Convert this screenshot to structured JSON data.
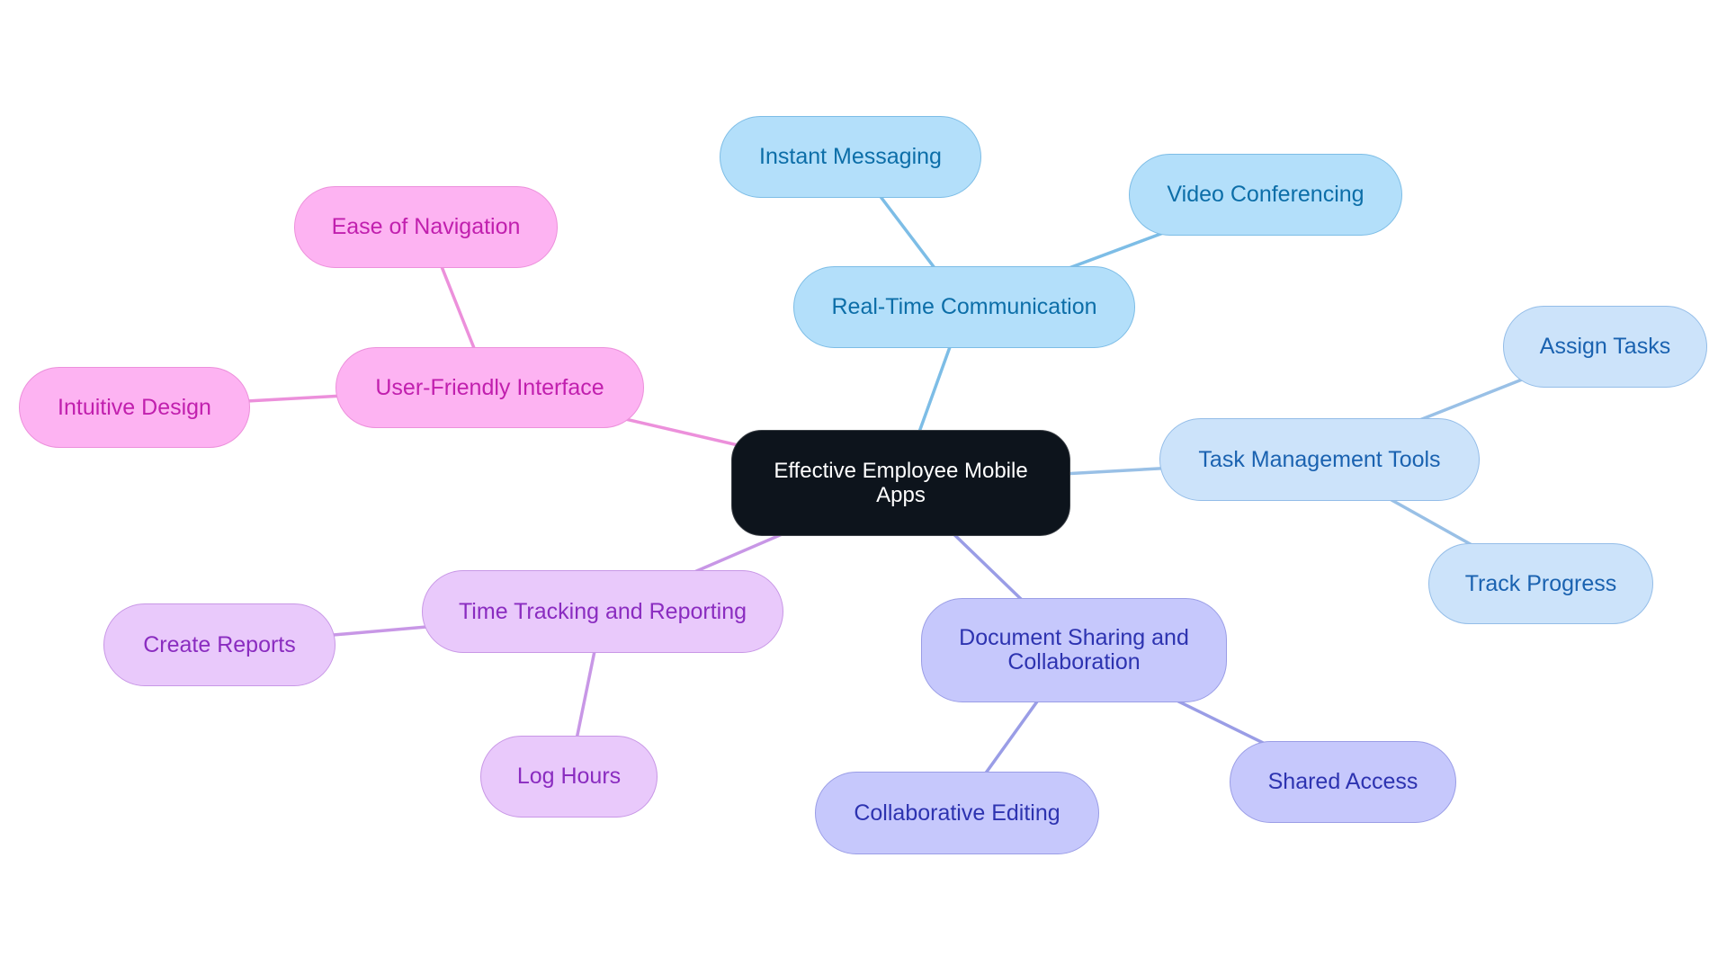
{
  "diagram": {
    "type": "mindmap",
    "root": {
      "id": "root",
      "label": "Effective Employee Mobile Apps"
    },
    "palette": {
      "root": {
        "fill": "#0d141c",
        "stroke": "#3a3f45",
        "text": "#ffffff"
      },
      "sky": {
        "fill": "#b3dffa",
        "stroke": "#7dbde6",
        "text": "#0c6ea8",
        "edge": "#7dbde6"
      },
      "light-blue": {
        "fill": "#cce3fa",
        "stroke": "#94bde8",
        "text": "#1a62b0",
        "edge": "#99c0e6"
      },
      "indigo": {
        "fill": "#c6c8fc",
        "stroke": "#9a9de6",
        "text": "#2d33b0",
        "edge": "#9a9de6"
      },
      "lavender": {
        "fill": "#e9c9fb",
        "stroke": "#c897e6",
        "text": "#8a2cc0",
        "edge": "#c897e6"
      },
      "pink": {
        "fill": "#fdb3f2",
        "stroke": "#ec90db",
        "text": "#c11fae",
        "edge": "#ec90db"
      }
    },
    "branches": [
      {
        "id": "rtc",
        "label": "Real-Time Communication",
        "color": "sky",
        "children": [
          {
            "id": "im",
            "label": "Instant Messaging"
          },
          {
            "id": "vc",
            "label": "Video Conferencing"
          }
        ]
      },
      {
        "id": "tmt",
        "label": "Task Management Tools",
        "color": "light-blue",
        "children": [
          {
            "id": "at",
            "label": "Assign Tasks"
          },
          {
            "id": "tp",
            "label": "Track Progress"
          }
        ]
      },
      {
        "id": "dsc",
        "label": "Document Sharing and Collaboration",
        "color": "indigo",
        "children": [
          {
            "id": "sa",
            "label": "Shared Access"
          },
          {
            "id": "ce",
            "label": "Collaborative Editing"
          }
        ]
      },
      {
        "id": "ttr",
        "label": "Time Tracking and Reporting",
        "color": "lavender",
        "children": [
          {
            "id": "cr",
            "label": "Create Reports"
          },
          {
            "id": "lh",
            "label": "Log Hours"
          }
        ]
      },
      {
        "id": "ufi",
        "label": "User-Friendly Interface",
        "color": "pink",
        "children": [
          {
            "id": "en",
            "label": "Ease of Navigation"
          },
          {
            "id": "idn",
            "label": "Intuitive Design"
          }
        ]
      }
    ]
  }
}
